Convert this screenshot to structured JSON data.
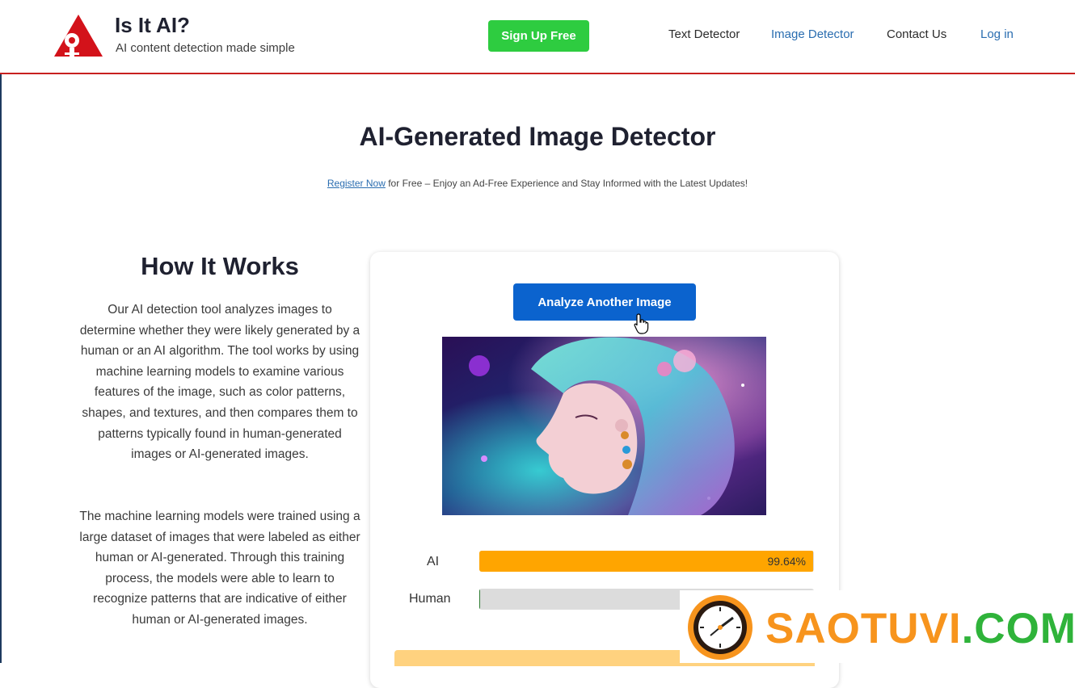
{
  "header": {
    "brand_title": "Is It AI?",
    "brand_tagline": "AI content detection made simple",
    "signup_label": "Sign Up Free",
    "nav": {
      "text_detector": "Text Detector",
      "image_detector": "Image Detector",
      "contact": "Contact Us",
      "login": "Log in"
    },
    "accent_color": "#c8201f"
  },
  "hero": {
    "title": "AI-Generated Image Detector",
    "register_link": "Register Now",
    "register_text": " for Free – Enjoy an Ad-Free Experience and Stay Informed with the Latest Updates!"
  },
  "how_it_works": {
    "title": "How It Works",
    "paragraph_1": "Our AI detection tool analyzes images to determine whether they were likely generated by a human or an AI algorithm. The tool works by using machine learning models to examine various features of the image, such as color patterns, shapes, and textures, and then compares them to patterns typically found in human-generated images or AI-generated images.",
    "paragraph_2": "The machine learning models were trained using a large dataset of images that were labeled as either human or AI-generated. Through this training process, the models were able to learn to recognize patterns that are indicative of either human or AI-generated images."
  },
  "detector": {
    "analyze_button": "Analyze Another Image",
    "results": [
      {
        "label": "AI",
        "value_text": "99.64%",
        "percent": 99.64,
        "color": "#ffa500"
      },
      {
        "label": "Human",
        "value_text": "",
        "percent": 0.36,
        "color": "#2e7d32"
      }
    ]
  },
  "watermark": {
    "text_orange": "SAOTUVI",
    "text_green": ".COM"
  },
  "icons": {
    "logo": "is-it-ai-logo-icon",
    "cursor": "hand-pointer-icon",
    "watermark_clock": "clock-icon"
  }
}
